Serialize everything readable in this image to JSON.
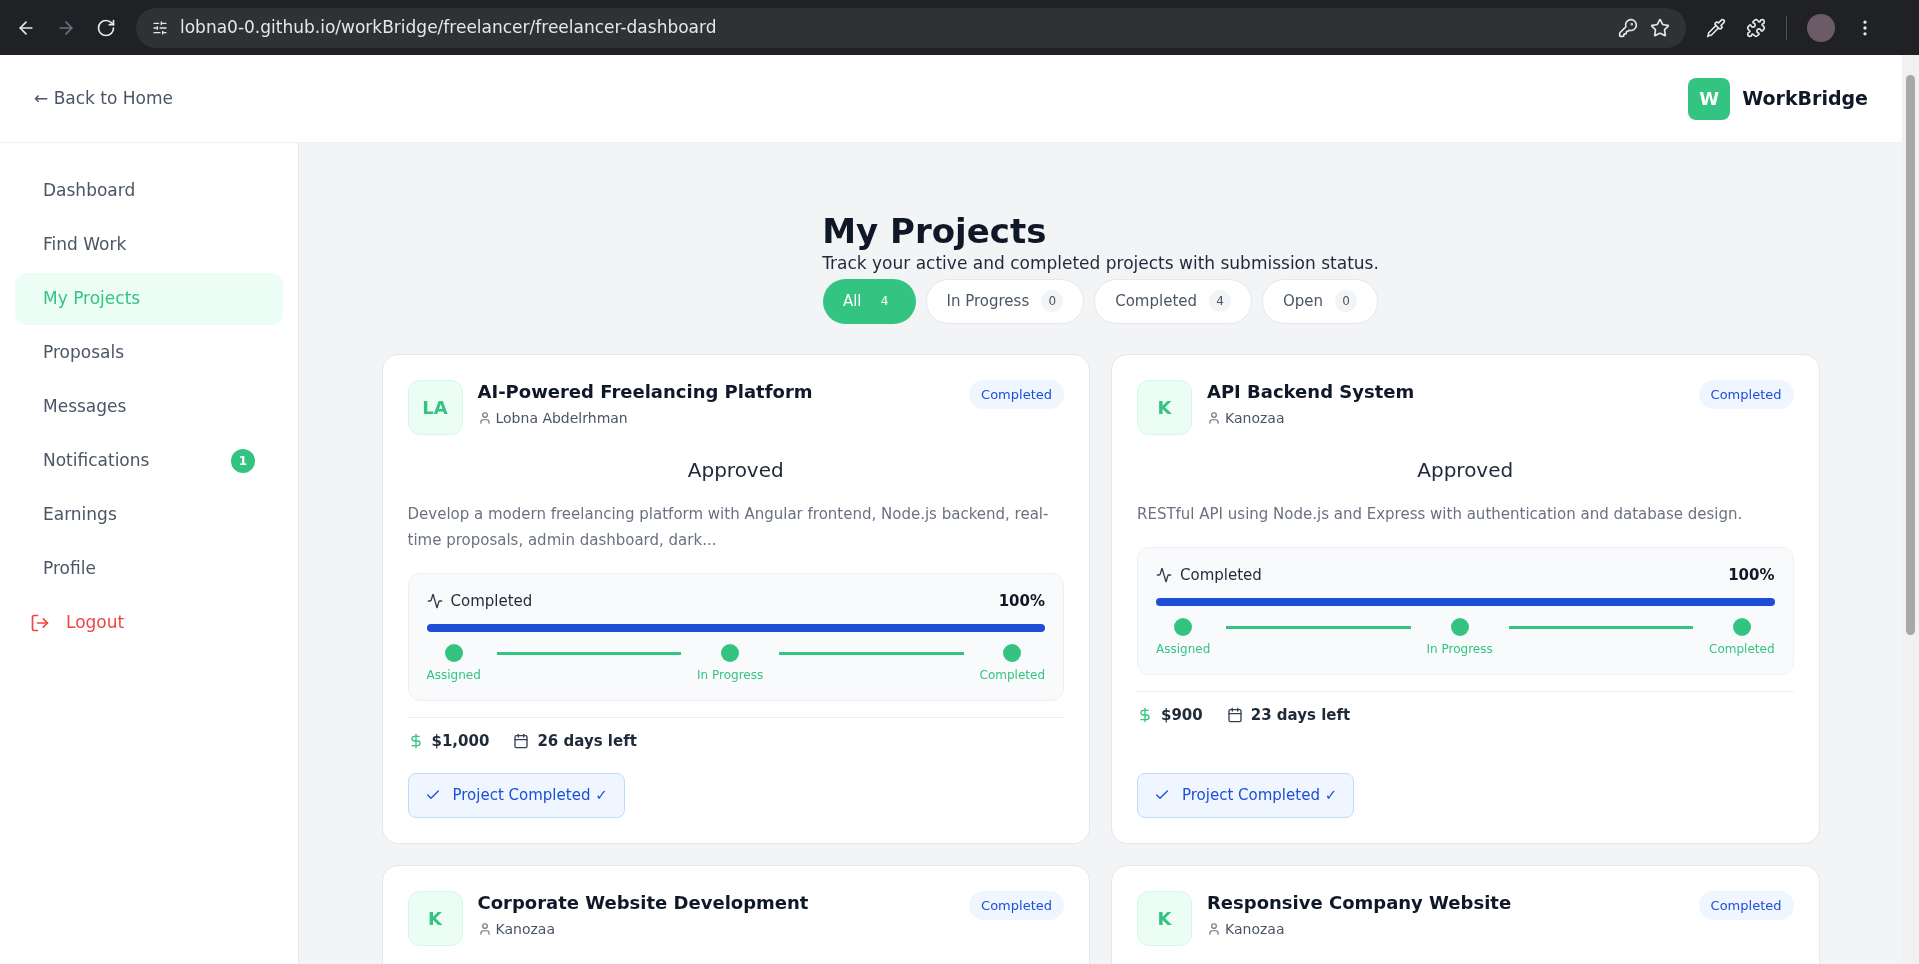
{
  "browser": {
    "url": "lobna0-0.github.io/workBridge/freelancer/freelancer-dashboard"
  },
  "header": {
    "back_link": "← Back to Home",
    "logo_letter": "W",
    "brand": "WorkBridge"
  },
  "sidebar": {
    "items": [
      {
        "label": "Dashboard",
        "selected": false
      },
      {
        "label": "Find Work",
        "selected": false
      },
      {
        "label": "My Projects",
        "selected": true
      },
      {
        "label": "Proposals",
        "selected": false
      },
      {
        "label": "Messages",
        "selected": false
      },
      {
        "label": "Notifications",
        "selected": false,
        "badge": "1"
      },
      {
        "label": "Earnings",
        "selected": false
      },
      {
        "label": "Profile",
        "selected": false
      }
    ],
    "logout": "Logout"
  },
  "page": {
    "title": "My Projects",
    "subtitle": "Track your active and completed projects with submission status."
  },
  "filters": [
    {
      "label": "All",
      "count": "4",
      "selected": true
    },
    {
      "label": "In Progress",
      "count": "0",
      "selected": false
    },
    {
      "label": "Completed",
      "count": "4",
      "selected": false
    },
    {
      "label": "Open",
      "count": "0",
      "selected": false
    }
  ],
  "projects": [
    {
      "initials": "LA",
      "title": "AI-Powered Freelancing Platform",
      "client": "Lobna Abdelrhman",
      "status": "Completed",
      "approval": "Approved",
      "description": "Develop a modern freelancing platform with Angular frontend, Node.js backend, real-time proposals, admin dashboard, dark...",
      "progress": {
        "label": "Completed",
        "percent": "100%",
        "level": 1,
        "steps": [
          {
            "label": "Assigned",
            "done": true
          },
          {
            "label": "In Progress",
            "done": true
          },
          {
            "label": "Completed",
            "done": true
          }
        ]
      },
      "budget": "$1,000",
      "deadline": "26 days left",
      "action": "Project Completed ✓"
    },
    {
      "initials": "K",
      "title": "API Backend System",
      "client": "Kanozaa",
      "status": "Completed",
      "approval": "Approved",
      "description": "RESTful API using Node.js and Express with authentication and database design.",
      "progress": {
        "label": "Completed",
        "percent": "100%",
        "level": 1,
        "steps": [
          {
            "label": "Assigned",
            "done": true
          },
          {
            "label": "In Progress",
            "done": true
          },
          {
            "label": "Completed",
            "done": true
          }
        ]
      },
      "budget": "$900",
      "deadline": "23 days left",
      "action": "Project Completed ✓"
    },
    {
      "initials": "K",
      "title": "Corporate Website Development",
      "client": "Kanozaa",
      "status": "Completed"
    },
    {
      "initials": "K",
      "title": "Responsive Company Website",
      "client": "Kanozaa",
      "status": "Completed"
    }
  ]
}
